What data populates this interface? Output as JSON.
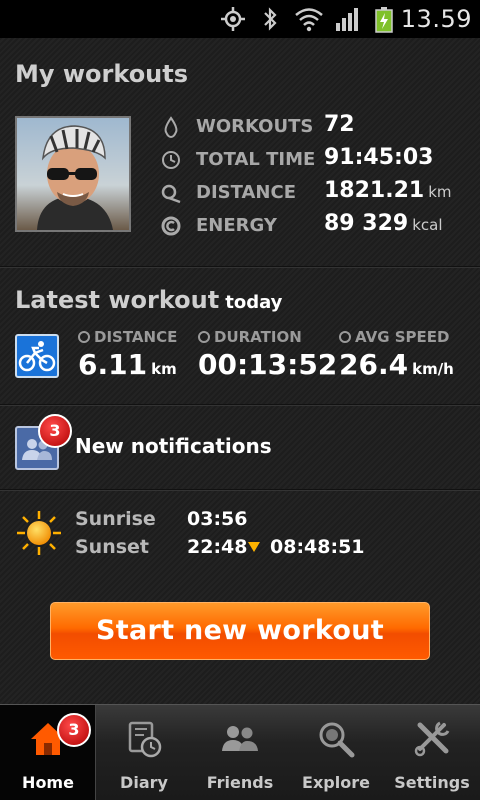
{
  "status_bar": {
    "time": "13.59"
  },
  "my_workouts": {
    "title": "My workouts",
    "stats": [
      {
        "icon": "drop-icon",
        "label": "WORKOUTS",
        "value": "72",
        "unit": ""
      },
      {
        "icon": "clock-icon",
        "label": "TOTAL TIME",
        "value": "91:45:03",
        "unit": ""
      },
      {
        "icon": "distance-icon",
        "label": "DISTANCE",
        "value": "1821.21",
        "unit": "km"
      },
      {
        "icon": "energy-icon",
        "label": "ENERGY",
        "value": "89 329",
        "unit": "kcal"
      }
    ]
  },
  "latest_workout": {
    "title": "Latest workout",
    "subtitle": "today",
    "sport_icon": "cycling-icon",
    "distance": {
      "label": "DISTANCE",
      "value": "6.11",
      "unit": "km"
    },
    "duration": {
      "label": "DURATION",
      "value": "00:13:52"
    },
    "avg_speed": {
      "label": "AVG SPEED",
      "value": "26.4",
      "unit": "km/h"
    }
  },
  "notifications": {
    "count": "3",
    "label": "New notifications"
  },
  "sun": {
    "sunrise_label": "Sunrise",
    "sunrise": "03:56",
    "sunset_label": "Sunset",
    "sunset": "22:48",
    "day_length": "08:48:51"
  },
  "start_button": {
    "label": "Start new workout"
  },
  "nav": {
    "home_badge": "3",
    "tabs": [
      {
        "label": "Home",
        "icon": "home-icon"
      },
      {
        "label": "Diary",
        "icon": "diary-icon"
      },
      {
        "label": "Friends",
        "icon": "friends-icon"
      },
      {
        "label": "Explore",
        "icon": "explore-icon"
      },
      {
        "label": "Settings",
        "icon": "settings-icon"
      }
    ]
  },
  "colors": {
    "accent": "#ff6a00",
    "badge": "#d01010",
    "sport_blue": "#1a73d9"
  }
}
